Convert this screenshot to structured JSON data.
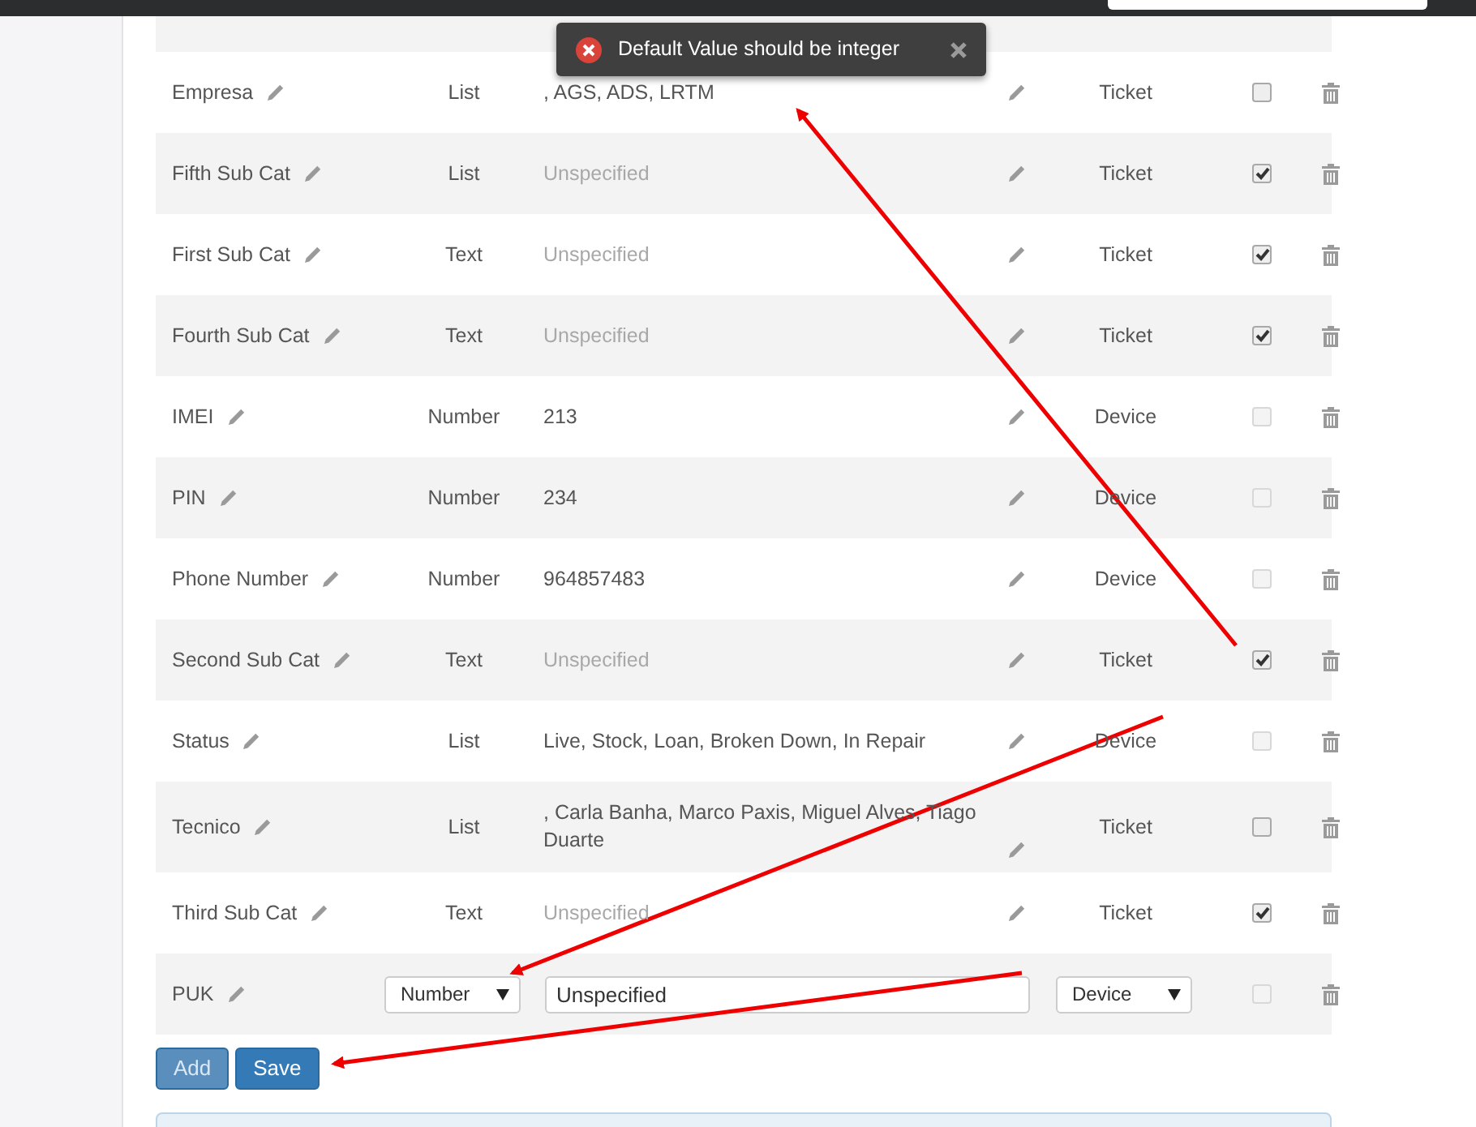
{
  "toast": {
    "message": "Default Value should be integer"
  },
  "fields": [
    {
      "kind": "cut"
    },
    {
      "kind": "row",
      "name": "Empresa",
      "type": "List",
      "default": ", AGS, ADS, LRTM",
      "unset": false,
      "target": "Ticket",
      "checked": false,
      "disabled": false
    },
    {
      "kind": "row",
      "name": "Fifth Sub Cat",
      "type": "List",
      "default": "Unspecified",
      "unset": true,
      "target": "Ticket",
      "checked": true,
      "disabled": false
    },
    {
      "kind": "row",
      "name": "First Sub Cat",
      "type": "Text",
      "default": "Unspecified",
      "unset": true,
      "target": "Ticket",
      "checked": true,
      "disabled": false
    },
    {
      "kind": "row",
      "name": "Fourth Sub Cat",
      "type": "Text",
      "default": "Unspecified",
      "unset": true,
      "target": "Ticket",
      "checked": true,
      "disabled": false
    },
    {
      "kind": "row",
      "name": "IMEI",
      "type": "Number",
      "default": "213",
      "unset": false,
      "target": "Device",
      "checked": false,
      "disabled": true
    },
    {
      "kind": "row",
      "name": "PIN",
      "type": "Number",
      "default": "234",
      "unset": false,
      "target": "Device",
      "checked": false,
      "disabled": true
    },
    {
      "kind": "row",
      "name": "Phone Number",
      "type": "Number",
      "default": "964857483",
      "unset": false,
      "target": "Device",
      "checked": false,
      "disabled": true
    },
    {
      "kind": "row",
      "name": "Second Sub Cat",
      "type": "Text",
      "default": "Unspecified",
      "unset": true,
      "target": "Ticket",
      "checked": true,
      "disabled": false
    },
    {
      "kind": "row",
      "name": "Status",
      "type": "List",
      "default": "Live, Stock, Loan, Broken Down, In Repair",
      "unset": false,
      "target": "Device",
      "checked": false,
      "disabled": true
    },
    {
      "kind": "row",
      "name": "Tecnico",
      "type": "List",
      "default": ", Carla Banha, Marco Paxis, Miguel Alves, Tiago Duarte",
      "unset": false,
      "target": "Ticket",
      "checked": false,
      "disabled": false
    },
    {
      "kind": "row",
      "name": "Third Sub Cat",
      "type": "Text",
      "default": "Unspecified",
      "unset": true,
      "target": "Ticket",
      "checked": true,
      "disabled": false
    },
    {
      "kind": "edit",
      "name": "PUK",
      "type": "Number",
      "default": "Unspecified",
      "target": "Device",
      "checked": false,
      "disabled": true
    }
  ],
  "buttons": [
    {
      "label": "Add",
      "disabled": true
    },
    {
      "label": "Save",
      "disabled": false
    }
  ]
}
